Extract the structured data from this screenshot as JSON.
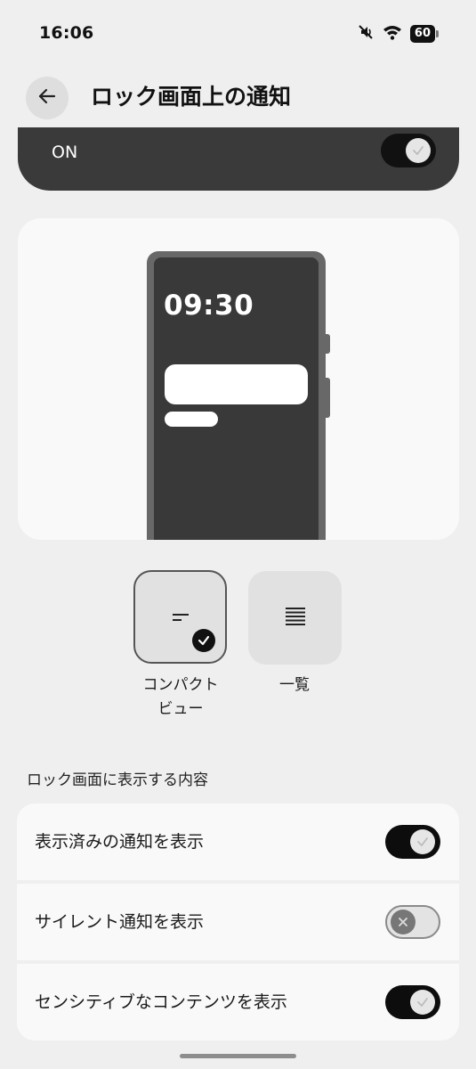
{
  "status_bar": {
    "time": "16:06",
    "battery": "60"
  },
  "header": {
    "title": "ロック画面上の通知"
  },
  "master_toggle": {
    "label": "ON",
    "state": "on"
  },
  "preview": {
    "clock": "09:30"
  },
  "display_options": [
    {
      "label_line1": "コンパクト",
      "label_line2": "ビュー",
      "selected": true
    },
    {
      "label_line1": "一覧",
      "label_line2": "",
      "selected": false
    }
  ],
  "section": {
    "title": "ロック画面に表示する内容"
  },
  "settings": [
    {
      "label": "表示済みの通知を表示",
      "state": "on"
    },
    {
      "label": "サイレント通知を表示",
      "state": "off"
    },
    {
      "label": "センシティブなコンテンツを表示",
      "state": "on"
    }
  ],
  "colors": {
    "background": "#efefef",
    "card": "#f9f9f9",
    "switch_on": "#0d0d0d",
    "banner": "#3a3a3a"
  }
}
